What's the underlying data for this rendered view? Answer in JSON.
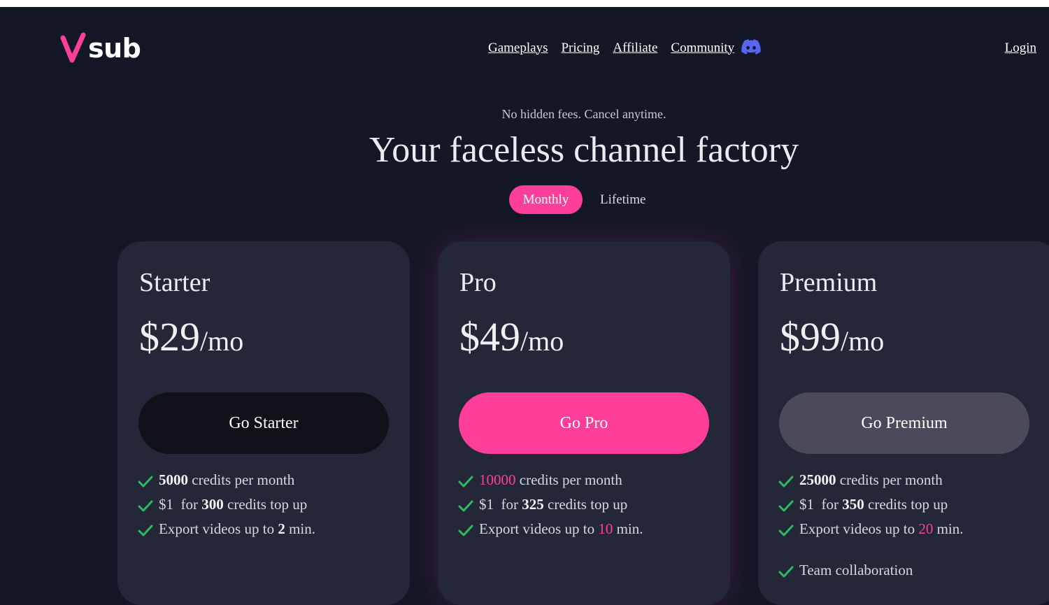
{
  "header": {
    "logo_text": "sub",
    "nav": [
      "Gameplays",
      "Pricing",
      "Affiliate",
      "Community"
    ],
    "login": "Login",
    "icons": [
      "v-logo-icon",
      "discord-icon"
    ]
  },
  "hero": {
    "subtitle": "No hidden fees. Cancel anytime.",
    "headline": "Your faceless channel factory",
    "toggle": {
      "monthly": "Monthly",
      "lifetime": "Lifetime",
      "selected": "Monthly"
    }
  },
  "colors": {
    "background": "#131726",
    "card": "#242737",
    "accent": "#ff3e9a",
    "check": "#2dbb5e"
  },
  "plans": [
    {
      "name": "Starter",
      "price": "$29",
      "period": "/mo",
      "cta": "Go Starter",
      "credits": "5000",
      "credits_suffix": " credits per month",
      "topup_prefix": "$1  for ",
      "topup_amount": "300",
      "topup_suffix": " credits top up",
      "export_prefix": "Export videos up to ",
      "export_minutes": "2",
      "export_suffix": " min."
    },
    {
      "name": "Pro",
      "price": "$49",
      "period": "/mo",
      "cta": "Go Pro",
      "credits": "10000",
      "credits_suffix": " credits per month",
      "topup_prefix": "$1  for ",
      "topup_amount": "325",
      "topup_suffix": " credits top up",
      "export_prefix": "Export videos up to ",
      "export_minutes": "10",
      "export_suffix": " min."
    },
    {
      "name": "Premium",
      "price": "$99",
      "period": "/mo",
      "cta": "Go Premium",
      "credits": "25000",
      "credits_suffix": " credits per month",
      "topup_prefix": "$1  for ",
      "topup_amount": "350",
      "topup_suffix": " credits top up",
      "export_prefix": "Export videos up to ",
      "export_minutes": "20",
      "export_suffix": " min.",
      "extra_feature": "Team collaboration"
    }
  ]
}
